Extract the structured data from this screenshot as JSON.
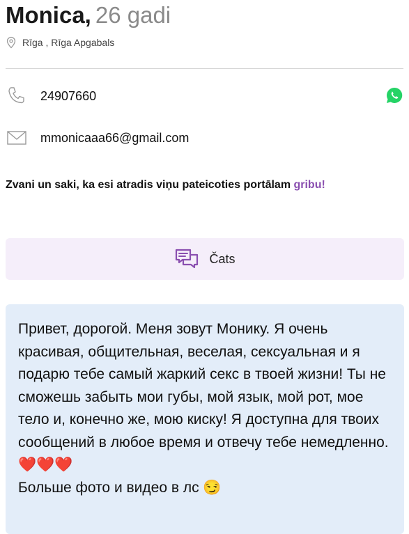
{
  "profile": {
    "name": "Monica,",
    "age": "26 gadi",
    "location": "Rīga ,  Rīga Apgabals"
  },
  "contacts": {
    "phone": "24907660",
    "email": "mmonicaaa66@gmail.com"
  },
  "cta": {
    "text": "Zvani un saki, ka esi atradis viņu pateicoties portālam ",
    "brand": "gribu!"
  },
  "chat": {
    "label": "Čats"
  },
  "description": {
    "text": "Привет, дорогой. Меня зовут Монику. Я очень красивая, общительная, веселая, сексуальная и я подарю тебе самый жаркий секс в твоей жизни! Ты не сможешь забыть мои губы, мой язык, мой рот, мое тело и, конечно же, мою киску! Я доступна для твоих сообщений в любое время и отвечу тебе немедленно.",
    "hearts": "❤️❤️❤️",
    "more": "Больше фото и видео в лс 😏"
  },
  "colors": {
    "brand": "#8a4fb0",
    "whatsapp": "#25d366",
    "chat_bg": "#f5eefa",
    "desc_bg": "#e3edf9"
  }
}
